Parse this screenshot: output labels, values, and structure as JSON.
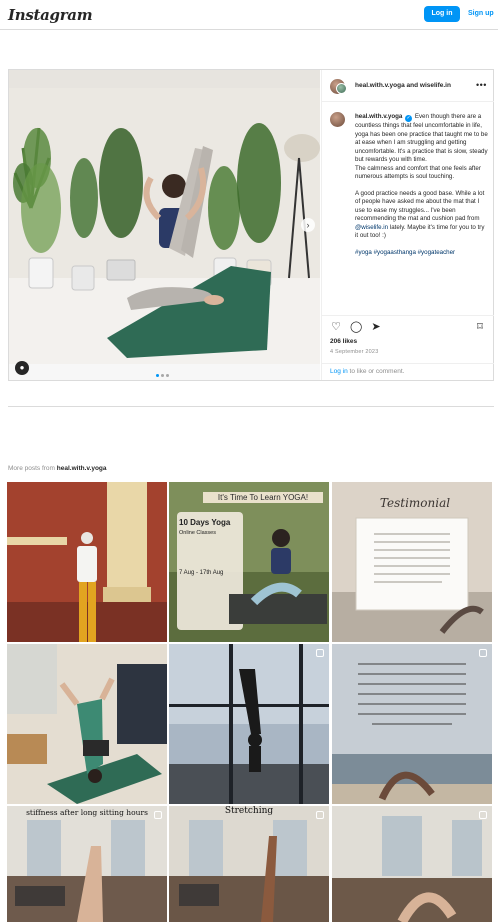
{
  "header": {
    "logo": "Instagram",
    "login_label": "Log in",
    "signup_label": "Sign up"
  },
  "post": {
    "authors": "heal.with.v.yoga and wiselife.in",
    "caption": {
      "username": "heal.with.v.yoga",
      "text_1": "Even though there are a countless things that feel uncomfortable in life, yoga has been one practice that taught me to be at ease when I am struggling and getting uncomfortable. It's a practice that is slow, steady but rewards you with time.",
      "text_2": "The calmness and comfort that one feels after numerous attempts is soul touching.",
      "text_3a": "A good practice needs a good base. While a lot of people have asked me about the mat that I use to ease my struggles... I've been recommending the mat and cushion pad from",
      "mention": "@wiselife.in",
      "text_3b": "lately. Maybe it's time for you to try it out too! :)",
      "hashtags": "#yoga #yogaasthanga #yogateacher"
    },
    "likes": "206 likes",
    "date": "4 September 2023",
    "login_prompt_link": "Log in",
    "login_prompt_rest": "to like or comment."
  },
  "more_posts": {
    "label_prefix": "More posts from",
    "username": "heal.with.v.yoga"
  },
  "grid_texts": {
    "learn_banner": "It's Time To Learn YOGA!",
    "days_title": "10 Days Yoga",
    "days_sub": "Online Classes",
    "days_dates": "7 Aug - 17th Aug",
    "testimonial": "Testimonial",
    "stiffness": "stiffness after long sitting hours",
    "stretching": "Stretching"
  },
  "colors": {
    "accent": "#0095f6",
    "mat": "#2f6b55",
    "text": "#262626",
    "muted": "#8e8e8e"
  },
  "icons": [
    "heart-icon",
    "comment-icon",
    "share-icon",
    "bookmark-icon",
    "more-icon",
    "tag-icon",
    "verified-icon",
    "chevron-right-icon",
    "multi-image-icon"
  ]
}
